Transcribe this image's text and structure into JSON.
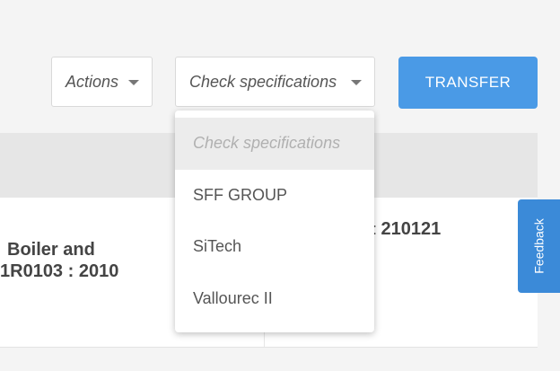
{
  "toolbar": {
    "actions_label": "Actions",
    "spec_label": "Check specifications",
    "transfer_label": "TRANSFER"
  },
  "dropdown": {
    "items": [
      {
        "label": "Check specifications"
      },
      {
        "label": "SFF GROUP"
      },
      {
        "label": "SiTech"
      },
      {
        "label": "Vallourec II"
      }
    ]
  },
  "table": {
    "row": {
      "line1": "Boiler and",
      "line2": "1R0103 : 2010",
      "right_label": "t:",
      "right_value": "210121"
    }
  },
  "feedback": {
    "label": "Feedback"
  },
  "colors": {
    "accent": "#4a9ae6",
    "feedback": "#3b8ad8",
    "background": "#f4f4f4",
    "header": "#e6e6e6"
  }
}
